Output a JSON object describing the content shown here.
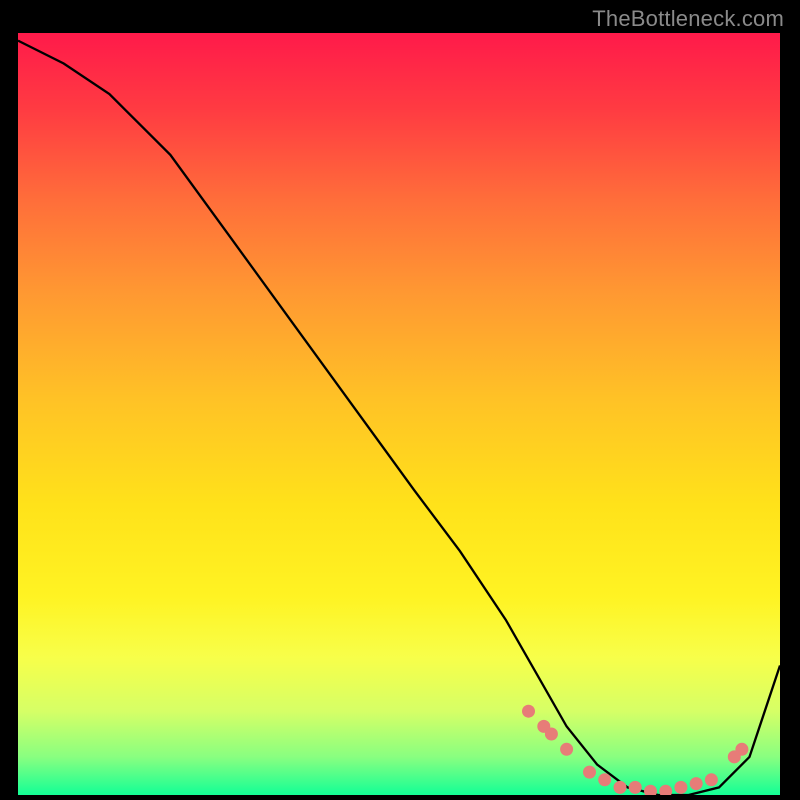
{
  "watermark": {
    "text": "TheBottleneck.com"
  },
  "chart_data": {
    "type": "line",
    "title": "",
    "xlabel": "",
    "ylabel": "",
    "xlim": [
      0,
      100
    ],
    "ylim": [
      0,
      100
    ],
    "series": [
      {
        "name": "bottleneck-curve",
        "x": [
          0,
          6,
          12,
          20,
          28,
          36,
          44,
          52,
          58,
          64,
          68,
          72,
          76,
          80,
          84,
          88,
          92,
          96,
          100
        ],
        "y": [
          99,
          96,
          92,
          84,
          73,
          62,
          51,
          40,
          32,
          23,
          16,
          9,
          4,
          1,
          0,
          0,
          1,
          5,
          17
        ]
      }
    ],
    "markers": {
      "name": "highlight-dots",
      "color": "#e77c78",
      "points": [
        {
          "x": 67,
          "y": 11
        },
        {
          "x": 69,
          "y": 9
        },
        {
          "x": 70,
          "y": 8
        },
        {
          "x": 72,
          "y": 6
        },
        {
          "x": 75,
          "y": 3
        },
        {
          "x": 77,
          "y": 2
        },
        {
          "x": 79,
          "y": 1
        },
        {
          "x": 81,
          "y": 1
        },
        {
          "x": 83,
          "y": 0.5
        },
        {
          "x": 85,
          "y": 0.5
        },
        {
          "x": 87,
          "y": 1
        },
        {
          "x": 89,
          "y": 1.5
        },
        {
          "x": 91,
          "y": 2
        },
        {
          "x": 94,
          "y": 5
        },
        {
          "x": 95,
          "y": 6
        }
      ]
    }
  }
}
